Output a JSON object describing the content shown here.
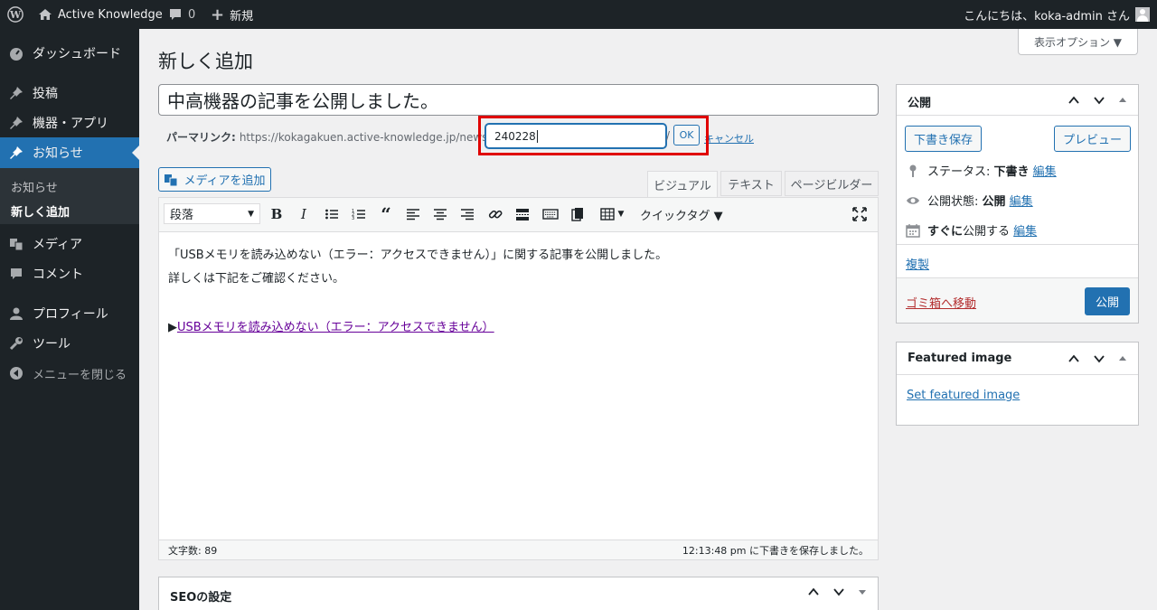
{
  "adminbar": {
    "site_name": "Active Knowledge",
    "comments_count": "0",
    "new_label": "新規",
    "greeting": "こんにちは、koka-admin さん"
  },
  "menu": {
    "items": [
      {
        "label": "ダッシュボード",
        "icon": "dashboard-icon"
      },
      {
        "label": "投稿",
        "icon": "pin-icon"
      },
      {
        "label": "機器・アプリ",
        "icon": "pin-icon"
      },
      {
        "label": "お知らせ",
        "icon": "pin-icon"
      },
      {
        "label": "メディア",
        "icon": "media-icon"
      },
      {
        "label": "コメント",
        "icon": "comment-icon"
      },
      {
        "label": "プロフィール",
        "icon": "user-icon"
      },
      {
        "label": "ツール",
        "icon": "wrench-icon"
      },
      {
        "label": "メニューを閉じる",
        "icon": "collapse-icon"
      }
    ],
    "submenu": [
      "お知らせ",
      "新しく追加"
    ]
  },
  "screen_options": "表示オプション ▼",
  "page_title": "新しく追加",
  "post_title": "中高機器の記事を公開しました。",
  "permalink": {
    "label": "パーマリンク:",
    "base": "https://kokagakuen.active-knowledge.jp/news/",
    "slug": "240228",
    "trail": "/",
    "ok": "OK",
    "cancel": "キャンセル"
  },
  "add_media": "メディアを追加",
  "editor_tabs": [
    "ビジュアル",
    "テキスト",
    "ページビルダー"
  ],
  "format_select": "段落",
  "quicktag": "クイックタグ ▼",
  "content": {
    "line1": "「USBメモリを読み込めない（エラー：アクセスできません）」に関する記事を公開しました。",
    "line2": "詳しくは下記をご確認ください。",
    "arrow": "▶",
    "link": "USBメモリを読み込めない（エラー：アクセスできません）"
  },
  "status_bar": {
    "word_count": "文字数: 89",
    "saved": "12:13:48 pm に下書きを保存しました。"
  },
  "seo_box": "SEOの設定",
  "publish": {
    "title": "公開",
    "save_draft": "下書き保存",
    "preview": "プレビュー",
    "status_label": "ステータス: ",
    "status_value": "下書き",
    "visibility_label": "公開状態: ",
    "visibility_value": "公開",
    "schedule_value": "すぐに",
    "schedule_label": "公開する",
    "edit": "編集",
    "duplicate": "複製",
    "trash": "ゴミ箱へ移動",
    "publish_btn": "公開"
  },
  "featured": {
    "title": "Featured image",
    "set": "Set featured image"
  },
  "colors": {
    "accent": "#2271b1",
    "highlight_box": "#e00000",
    "link_visited": "#660099",
    "trash": "#b32d2e"
  }
}
